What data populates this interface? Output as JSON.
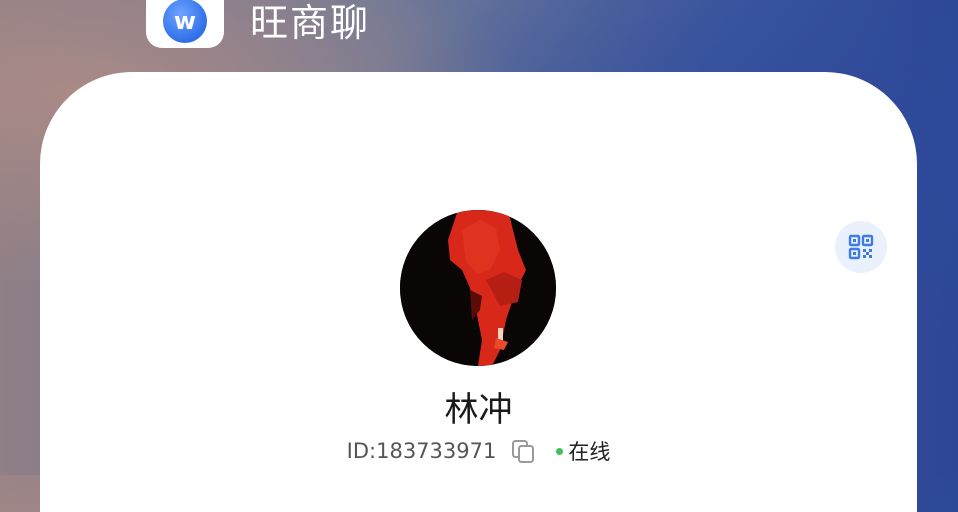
{
  "app": {
    "name": "旺商聊",
    "icon_letter": "w"
  },
  "profile": {
    "name": "林冲",
    "id_text": "ID:183733971",
    "status": "在线"
  },
  "icons": {
    "qr": "qr-code-icon",
    "copy": "copy-icon",
    "app": "app-logo-icon"
  },
  "colors": {
    "accent": "#2f6fe8",
    "online": "#3fbf5a",
    "qr_bg": "#eaf1fd"
  }
}
